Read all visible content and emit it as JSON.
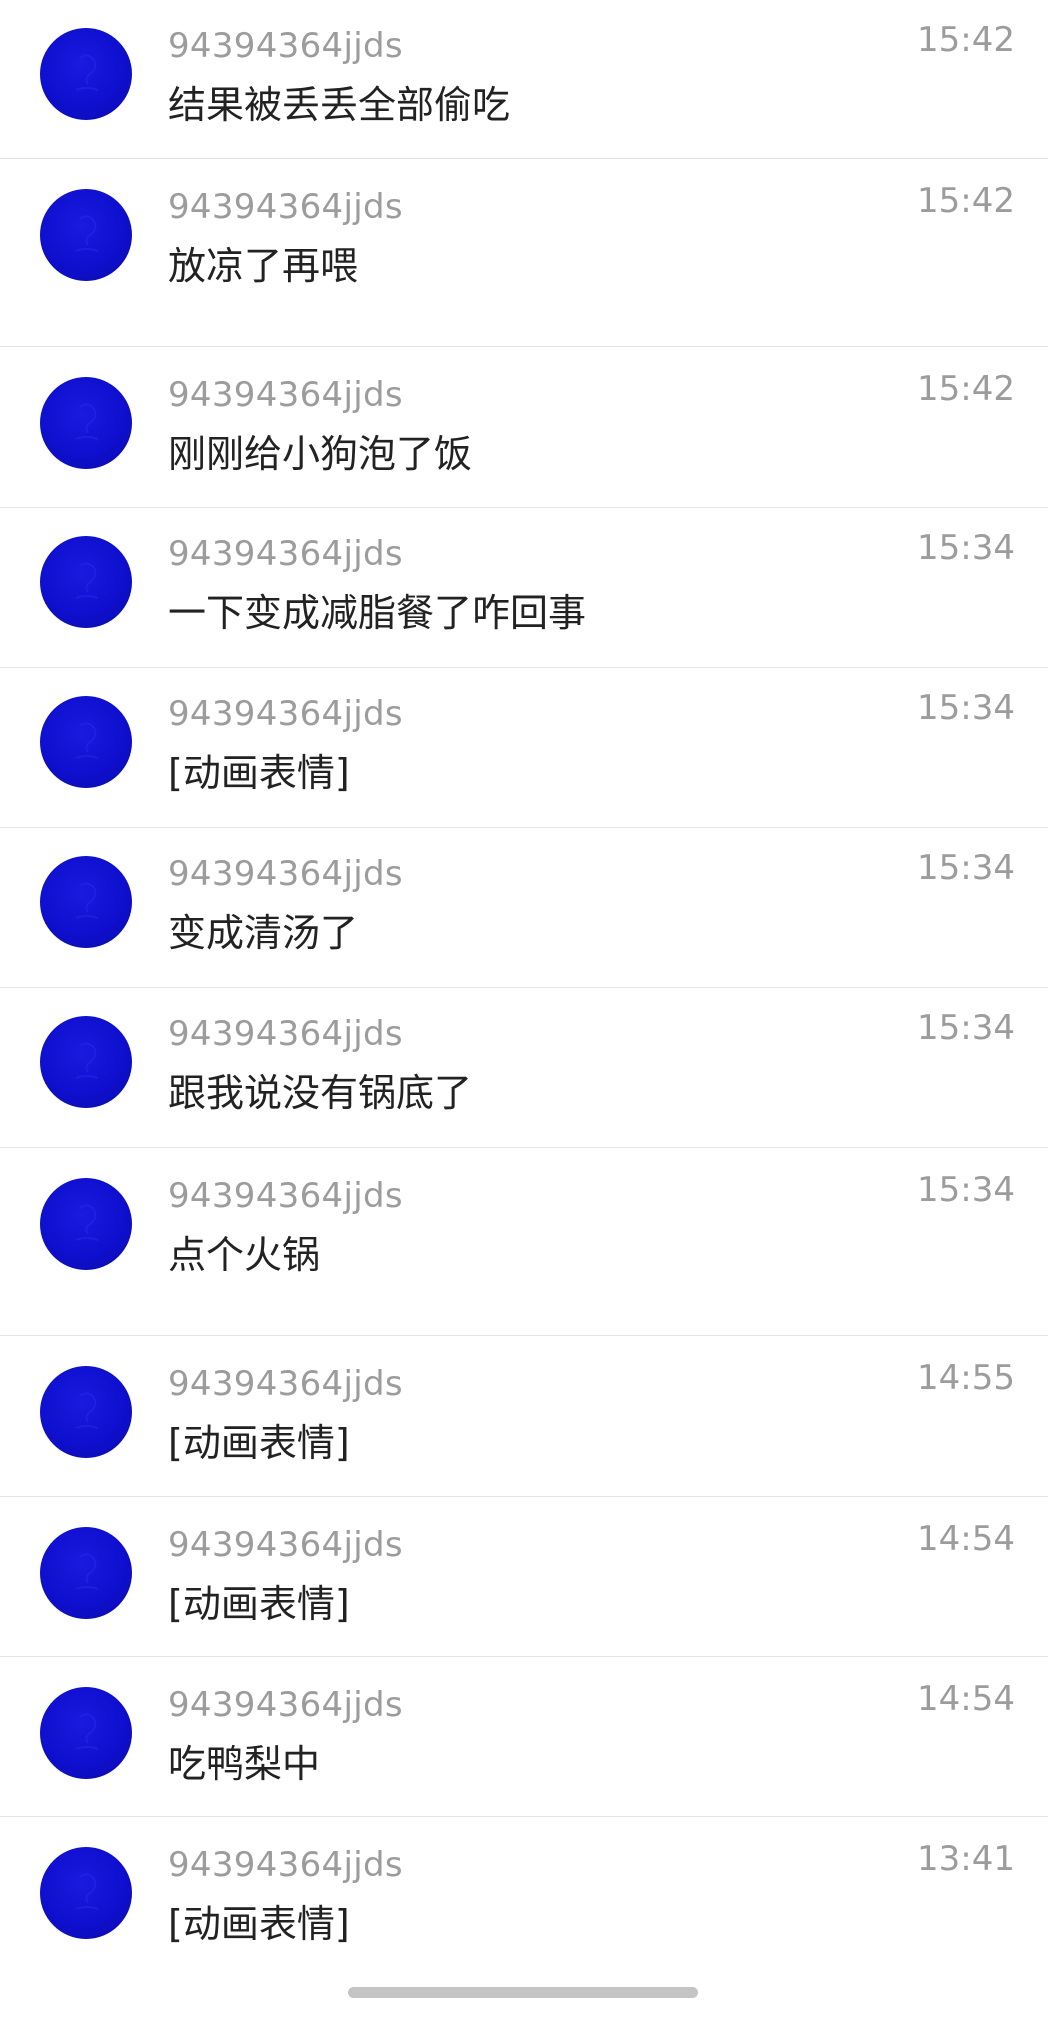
{
  "colors": {
    "avatar": "#1111d6",
    "name": "#9c9c9c",
    "message": "#222222",
    "divider": "#e3e3e3"
  },
  "messages": [
    {
      "name": "94394364jjds",
      "text": "结果被丢丢全部偷吃",
      "time": "15:42"
    },
    {
      "name": "94394364jjds",
      "text": "放凉了再喂",
      "time": "15:42"
    },
    {
      "name": "94394364jjds",
      "text": "刚刚给小狗泡了饭",
      "time": "15:42"
    },
    {
      "name": "94394364jjds",
      "text": "一下变成减脂餐了咋回事",
      "time": "15:34"
    },
    {
      "name": "94394364jjds",
      "text": "[动画表情]",
      "time": "15:34"
    },
    {
      "name": "94394364jjds",
      "text": "变成清汤了",
      "time": "15:34"
    },
    {
      "name": "94394364jjds",
      "text": "跟我说没有锅底了",
      "time": "15:34"
    },
    {
      "name": "94394364jjds",
      "text": "点个火锅",
      "time": "15:34"
    },
    {
      "name": "94394364jjds",
      "text": "[动画表情]",
      "time": "14:55"
    },
    {
      "name": "94394364jjds",
      "text": "[动画表情]",
      "time": "14:54"
    },
    {
      "name": "94394364jjds",
      "text": "吃鸭梨中",
      "time": "14:54"
    },
    {
      "name": "94394364jjds",
      "text": "[动画表情]",
      "time": "13:41"
    }
  ]
}
